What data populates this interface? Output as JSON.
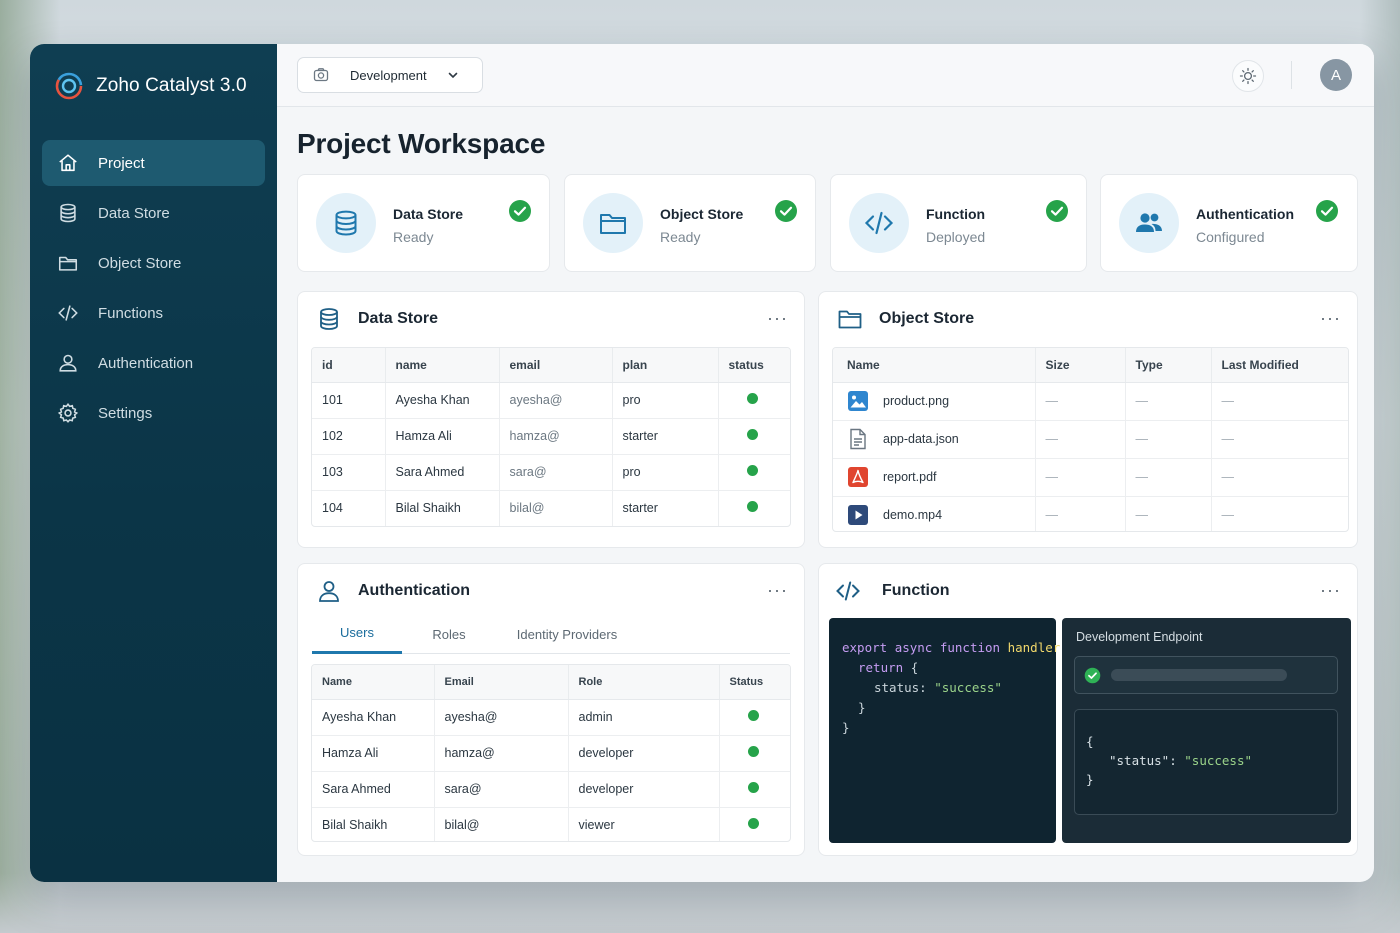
{
  "app": {
    "title": "Zoho Catalyst 3.0"
  },
  "sidebar": {
    "items": [
      {
        "label": "Project",
        "icon": "home-icon",
        "active": true
      },
      {
        "label": "Data Store",
        "icon": "database-icon",
        "active": false
      },
      {
        "label": "Object Store",
        "icon": "folder-icon",
        "active": false
      },
      {
        "label": "Functions",
        "icon": "code-icon",
        "active": false
      },
      {
        "label": "Authentication",
        "icon": "user-icon",
        "active": false
      },
      {
        "label": "Settings",
        "icon": "gear-icon",
        "active": false
      }
    ]
  },
  "topbar": {
    "environment": "Development",
    "avatar_initial": "A"
  },
  "page": {
    "title": "Project Workspace"
  },
  "status_cards": [
    {
      "title": "Data Store",
      "status": "Ready",
      "icon": "database-icon"
    },
    {
      "title": "Object Store",
      "status": "Ready",
      "icon": "folder-icon"
    },
    {
      "title": "Function",
      "status": "Deployed",
      "icon": "code-icon"
    },
    {
      "title": "Authentication",
      "status": "Configured",
      "icon": "users-icon"
    }
  ],
  "data_store": {
    "title": "Data Store",
    "columns": [
      "id",
      "name",
      "email",
      "plan",
      "status"
    ],
    "rows": [
      {
        "id": "101",
        "name": "Ayesha Khan",
        "email": "ayesha@",
        "plan": "pro"
      },
      {
        "id": "102",
        "name": "Hamza Ali",
        "email": "hamza@",
        "plan": "starter"
      },
      {
        "id": "103",
        "name": "Sara Ahmed",
        "email": "sara@",
        "plan": "pro"
      },
      {
        "id": "104",
        "name": "Bilal Shaikh",
        "email": "bilal@",
        "plan": "starter"
      }
    ]
  },
  "object_store": {
    "title": "Object Store",
    "columns": [
      "Name",
      "Size",
      "Type",
      "Last Modified"
    ],
    "placeholder": "—",
    "files": [
      {
        "name": "product.png",
        "icon": "image-file-icon"
      },
      {
        "name": "app-data.json",
        "icon": "document-file-icon"
      },
      {
        "name": "report.pdf",
        "icon": "pdf-file-icon"
      },
      {
        "name": "demo.mp4",
        "icon": "video-file-icon"
      }
    ]
  },
  "authentication": {
    "title": "Authentication",
    "tabs": [
      "Users",
      "Roles",
      "Identity Providers"
    ],
    "active_tab": "Users",
    "columns": [
      "Name",
      "Email",
      "Role",
      "Status"
    ],
    "rows": [
      {
        "name": "Ayesha Khan",
        "email": "ayesha@",
        "role": "admin"
      },
      {
        "name": "Hamza Ali",
        "email": "hamza@",
        "role": "developer"
      },
      {
        "name": "Sara Ahmed",
        "email": "sara@",
        "role": "developer"
      },
      {
        "name": "Bilal Shaikh",
        "email": "bilal@",
        "role": "viewer"
      }
    ]
  },
  "function": {
    "title": "Function",
    "code": {
      "kw_export": "export",
      "kw_async": "async",
      "kw_function": "function",
      "fn_name": "handler()",
      "open_brace": "{",
      "kw_return": "return",
      "return_brace": "{",
      "status_key": "status:",
      "status_value": "\"success\"",
      "inner_close": "}",
      "outer_close": "}"
    },
    "endpoint": {
      "title": "Development Endpoint",
      "response_open": "{",
      "response_key": "\"status\":",
      "response_value": "\"success\"",
      "response_close": "}"
    }
  },
  "colors": {
    "sidebar_bg": "#0f3e52",
    "accent": "#1f78ad",
    "success": "#26a34a",
    "code_bg": "#0f2430"
  }
}
